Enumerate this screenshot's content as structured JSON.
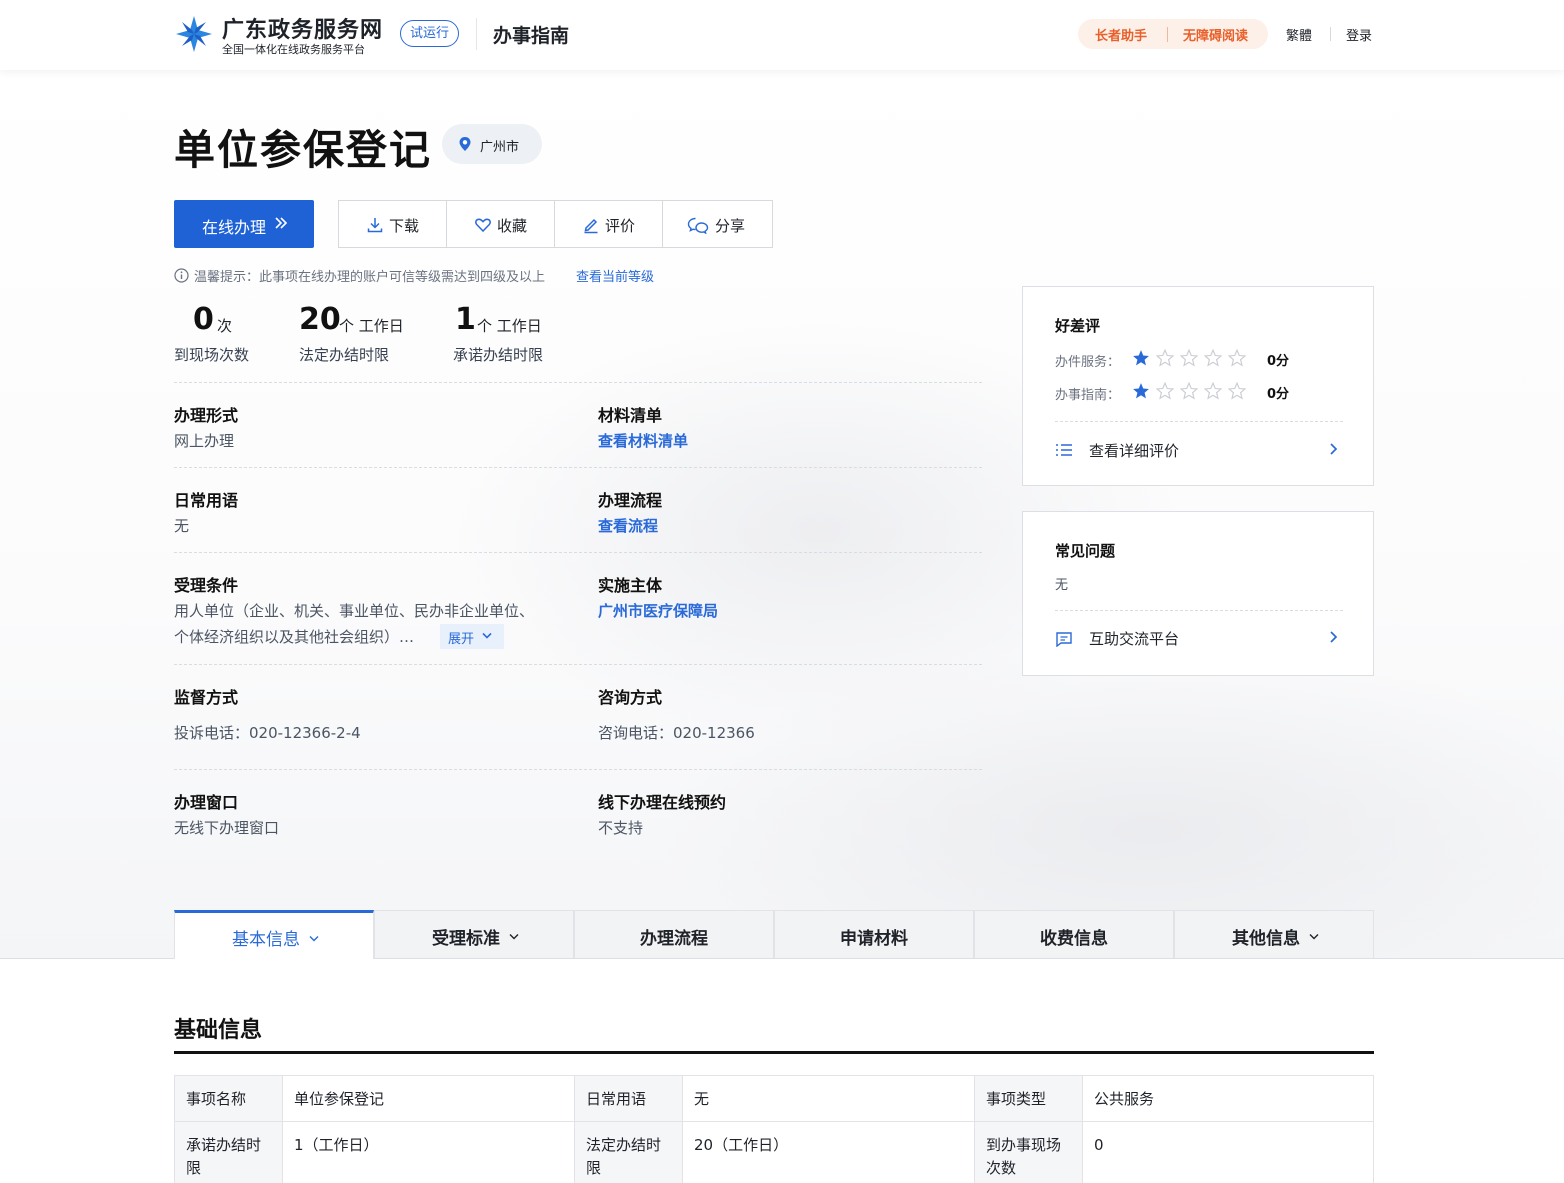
{
  "header": {
    "site_title": "广东政务服务网",
    "site_subtitle": "全国一体化在线政务服务平台",
    "beta_badge": "试运行",
    "section": "办事指南",
    "elder_assist": "长者助手",
    "accessible_reading": "无障碍阅读",
    "traditional": "繁體",
    "login": "登录"
  },
  "item": {
    "title": "单位参保登记",
    "region": "广州市"
  },
  "actions": {
    "online": "在线办理",
    "download": "下载",
    "favorite": "收藏",
    "rate": "评价",
    "share": "分享"
  },
  "tip": {
    "text": "温馨提示：此事项在线办理的账户可信等级需达到四级及以上",
    "link": "查看当前等级"
  },
  "stats": [
    {
      "num": "0",
      "unit": "次",
      "label": "到现场次数"
    },
    {
      "num": "20",
      "unit": "个 工作日",
      "label": "法定办结时限"
    },
    {
      "num": "1",
      "unit": "个 工作日",
      "label": "承诺办结时限"
    }
  ],
  "fields": {
    "form_label": "办理形式",
    "form_value": "网上办理",
    "materials_label": "材料清单",
    "materials_link": "查看材料清单",
    "terms_label": "日常用语",
    "terms_value": "无",
    "process_label": "办理流程",
    "process_link": "查看流程",
    "conditions_label": "受理条件",
    "conditions_line1": "用人单位（企业、机关、事业单位、民办非企业单位、",
    "conditions_line2": "个体经济组织以及其他社会组织）…",
    "expand": "展开",
    "subject_label": "实施主体",
    "subject_link": "广州市医疗保障局",
    "supervision_label": "监督方式",
    "supervision_value": "投诉电话：020-12366-2-4",
    "consult_label": "咨询方式",
    "consult_value": "咨询电话：020-12366",
    "window_label": "办理窗口",
    "window_value": "无线下办理窗口",
    "appointment_label": "线下办理在线预约",
    "appointment_value": "不支持"
  },
  "rating_card": {
    "title": "好差评",
    "service_label": "办件服务：",
    "service_score": "0分",
    "service_stars": 1,
    "guide_label": "办事指南：",
    "guide_score": "0分",
    "guide_stars": 1,
    "detail_link": "查看详细评价"
  },
  "faq_card": {
    "title": "常见问题",
    "value": "无",
    "platform_link": "互助交流平台"
  },
  "tabs": [
    {
      "label": "基本信息",
      "active": true,
      "has_menu": true
    },
    {
      "label": "受理标准",
      "active": false,
      "has_menu": true
    },
    {
      "label": "办理流程",
      "active": false,
      "has_menu": false
    },
    {
      "label": "申请材料",
      "active": false,
      "has_menu": false
    },
    {
      "label": "收费信息",
      "active": false,
      "has_menu": false
    },
    {
      "label": "其他信息",
      "active": false,
      "has_menu": true
    }
  ],
  "basic_info": {
    "title": "基础信息",
    "rows": [
      [
        [
          "事项名称",
          "单位参保登记"
        ],
        [
          "日常用语",
          "无"
        ],
        [
          "事项类型",
          "公共服务"
        ]
      ],
      [
        [
          "承诺办结时限",
          "1（工作日）"
        ],
        [
          "法定办结时限",
          "20（工作日）"
        ],
        [
          "到办事现场次数",
          "0"
        ]
      ]
    ]
  },
  "colors": {
    "primary": "#1e62d6",
    "link": "#2a6ad8",
    "accent_orange": "#e8602b",
    "star_filled": "#2a6ad8",
    "star_empty": "#c9ccd2"
  }
}
